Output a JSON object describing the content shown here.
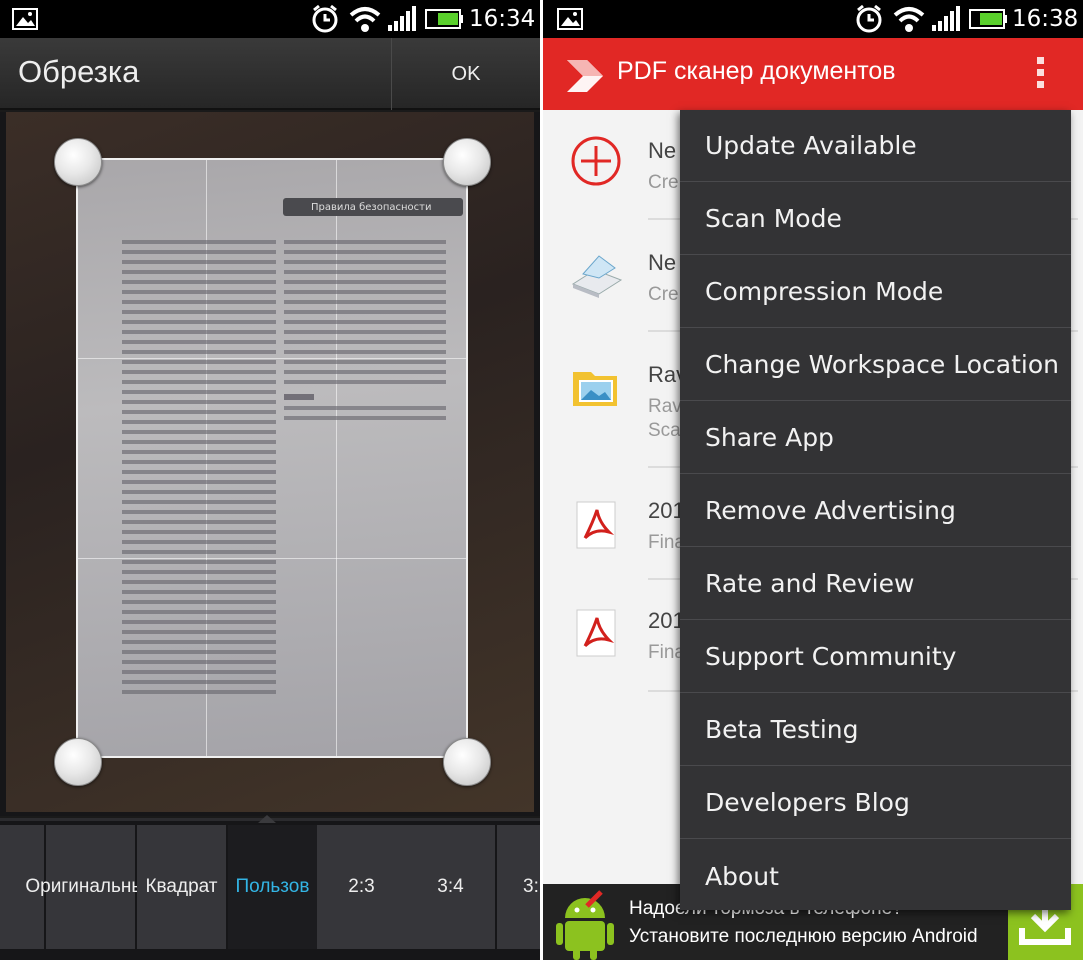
{
  "left": {
    "status": {
      "time": "16:34"
    },
    "title": "Обрезка",
    "ok_label": "OK",
    "ratios": [
      {
        "label": "Оригинальный",
        "selected": false
      },
      {
        "label": "Квадрат",
        "selected": false
      },
      {
        "label": "Пользов",
        "selected": true
      },
      {
        "label": "2:3",
        "selected": false
      },
      {
        "label": "3:4",
        "selected": false
      },
      {
        "label": "3:",
        "selected": false
      }
    ],
    "doc_header": "Правила безопасности"
  },
  "right": {
    "status": {
      "time": "16:38"
    },
    "app_title": "PDF сканер документов",
    "list": [
      {
        "icon": "add-circle-icon",
        "title": "Ne",
        "subtitle": "Cre"
      },
      {
        "icon": "scanner-icon",
        "title": "Ne",
        "subtitle": "Cre"
      },
      {
        "icon": "folder-image-icon",
        "title": "Rav",
        "subtitle": "Rav",
        "subtitle2": "Sca"
      },
      {
        "icon": "pdf-icon",
        "title": "201",
        "subtitle": "Fina"
      },
      {
        "icon": "pdf-icon",
        "title": "201",
        "subtitle": "Fina"
      }
    ],
    "menu": [
      "Update Available",
      "Scan Mode",
      "Compression Mode",
      "Change Workspace Location",
      "Share App",
      "Remove Advertising",
      "Rate and Review",
      "Support Community",
      "Beta Testing",
      "Developers Blog",
      "About"
    ],
    "ad": {
      "line1": "Надоели тормоза в телефоне?",
      "line2": "Установите последнюю версию Android"
    }
  },
  "colors": {
    "accent_red": "#e12825",
    "selected_blue": "#33b5e5",
    "ad_green": "#8cc21f"
  }
}
